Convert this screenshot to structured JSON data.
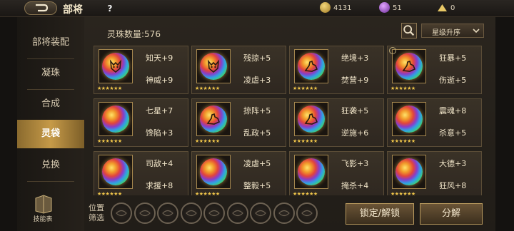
{
  "header": {
    "title": "部将",
    "help": "?",
    "currencies": [
      {
        "icon": "gold-coin-icon",
        "value": "4131",
        "color": "#c9a040"
      },
      {
        "icon": "purple-gem-icon",
        "value": "51",
        "color": "#b05ad6"
      },
      {
        "icon": "gold-pile-icon",
        "value": "0",
        "color": "#e8c866"
      }
    ]
  },
  "sidebar": {
    "items": [
      {
        "label": "部将装配"
      },
      {
        "label": "凝珠"
      },
      {
        "label": "合成"
      },
      {
        "label": "灵袋"
      },
      {
        "label": "兑换"
      }
    ],
    "active_index": 3,
    "skill_table": "技能表"
  },
  "main": {
    "count_label": "灵珠数量:576",
    "sort": "星级升序",
    "cards": [
      {
        "stat1": "知天+9",
        "stat2": "神威+9",
        "stars": "★★★★★★",
        "glyph": "beast"
      },
      {
        "stat1": "残掠+5",
        "stat2": "凌虐+3",
        "stars": "★★★★★★",
        "glyph": "beast"
      },
      {
        "stat1": "绝境+3",
        "stat2": "焚营+9",
        "stars": "★★★★★★",
        "glyph": "arm"
      },
      {
        "stat1": "狂暴+5",
        "stat2": "伤逝+5",
        "stars": "★★★★★★",
        "glyph": "arm",
        "locked": true
      },
      {
        "stat1": "七星+7",
        "stat2": "馋陷+3",
        "stars": "★★★★★★",
        "glyph": "none"
      },
      {
        "stat1": "掠阵+5",
        "stat2": "乱政+5",
        "stars": "★★★★★★",
        "glyph": "arm"
      },
      {
        "stat1": "狂袭+5",
        "stat2": "逆施+6",
        "stars": "★★★★★★",
        "glyph": "arm"
      },
      {
        "stat1": "震魂+8",
        "stat2": "杀意+5",
        "stars": "★★★★★★",
        "glyph": "none"
      },
      {
        "stat1": "司敌+4",
        "stat2": "求援+8",
        "stars": "★★★★★★",
        "glyph": "none"
      },
      {
        "stat1": "凌虐+5",
        "stat2": "整毅+5",
        "stars": "★★★★★★",
        "glyph": "none"
      },
      {
        "stat1": "飞影+3",
        "stat2": "掩杀+4",
        "stars": "★★★★★★",
        "glyph": "none"
      },
      {
        "stat1": "大德+3",
        "stat2": "狂风+8",
        "stars": "★★★★★★",
        "glyph": "none"
      }
    ]
  },
  "footer": {
    "filter_label": "位置筛选",
    "slots": 9,
    "lock_button": "锁定/解锁",
    "decompose_button": "分解"
  }
}
